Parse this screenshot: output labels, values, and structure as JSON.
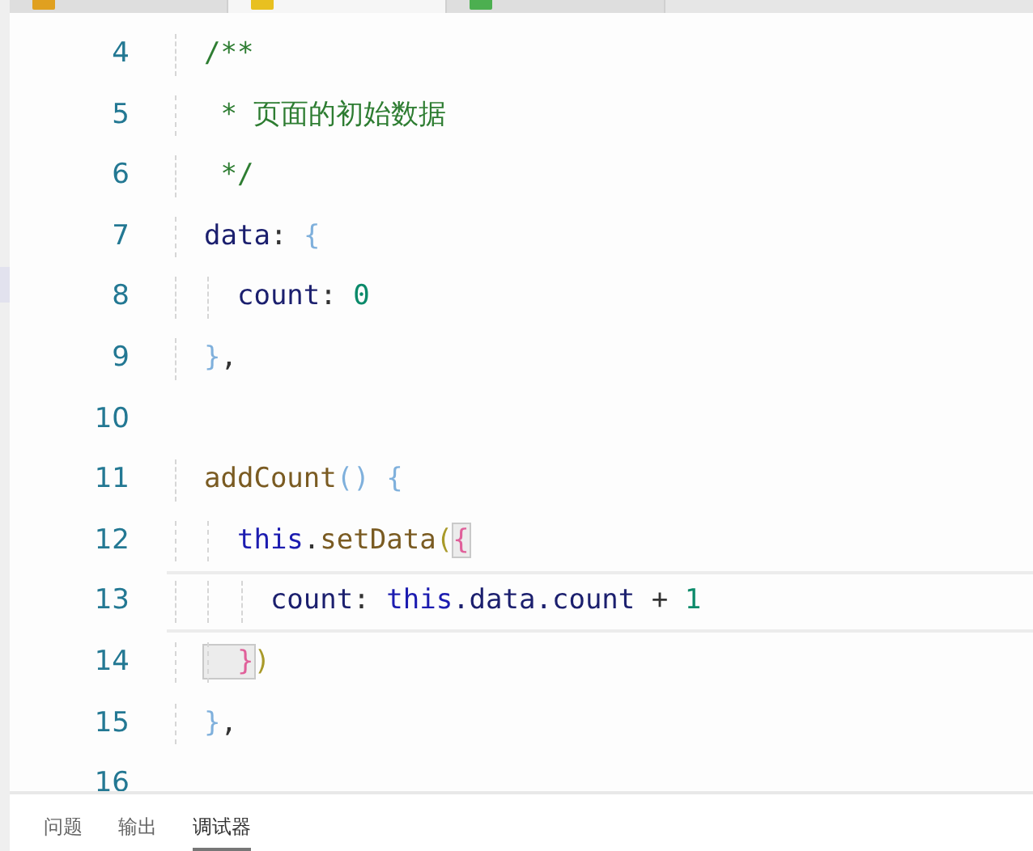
{
  "tabs": [
    {
      "selected": false
    },
    {
      "selected": true
    },
    {
      "selected": false
    }
  ],
  "editor": {
    "lines": [
      {
        "number": "4",
        "current": false,
        "tokens": [
          {
            "text": "/**",
            "kind": "comment"
          }
        ]
      },
      {
        "number": "5",
        "current": false,
        "tokens": [
          {
            "text": " * 页面的初始数据",
            "kind": "comment"
          }
        ]
      },
      {
        "number": "6",
        "current": false,
        "tokens": [
          {
            "text": " */",
            "kind": "comment"
          }
        ]
      },
      {
        "number": "7",
        "current": false,
        "tokens": [
          {
            "text": "data",
            "kind": "property"
          },
          {
            "text": ": ",
            "kind": "plain"
          },
          {
            "text": "{",
            "kind": "brace"
          }
        ]
      },
      {
        "number": "8",
        "current": false,
        "tokens": [
          {
            "text": "  count",
            "kind": "property"
          },
          {
            "text": ": ",
            "kind": "plain"
          },
          {
            "text": "0",
            "kind": "number"
          }
        ]
      },
      {
        "number": "9",
        "current": false,
        "tokens": [
          {
            "text": "}",
            "kind": "brace"
          },
          {
            "text": ",",
            "kind": "plain"
          }
        ]
      },
      {
        "number": "10",
        "current": false
      },
      {
        "number": "11",
        "current": false,
        "tokens": [
          {
            "text": "addCount",
            "kind": "function"
          },
          {
            "text": "() {",
            "kind": "brace"
          }
        ]
      },
      {
        "number": "12",
        "current": false,
        "tokens": [
          {
            "text": "  this",
            "kind": "keyword"
          },
          {
            "text": ".",
            "kind": "plain"
          },
          {
            "text": "setData",
            "kind": "function"
          },
          {
            "text": "(",
            "kind": "paren"
          },
          {
            "text": "{",
            "kind": "bracket",
            "matched": true
          }
        ]
      },
      {
        "number": "13",
        "current": true,
        "tokens": [
          {
            "text": "    count",
            "kind": "property"
          },
          {
            "text": ": ",
            "kind": "plain"
          },
          {
            "text": "this",
            "kind": "keyword"
          },
          {
            "text": ".data.count",
            "kind": "property"
          },
          {
            "text": " + ",
            "kind": "plain"
          },
          {
            "text": "1",
            "kind": "number"
          }
        ]
      },
      {
        "number": "14",
        "current": false,
        "tokens": [
          {
            "text": "  }",
            "kind": "bracket",
            "matched": true
          },
          {
            "text": ")",
            "kind": "paren"
          }
        ]
      },
      {
        "number": "15",
        "current": false,
        "tokens": [
          {
            "text": "}",
            "kind": "brace"
          },
          {
            "text": ",",
            "kind": "plain"
          }
        ]
      },
      {
        "number": "16",
        "current": false
      }
    ]
  },
  "panel_tabs": [
    {
      "label": "问题",
      "selected": false
    },
    {
      "label": "输出",
      "selected": false
    },
    {
      "label": "调试器",
      "selected": true
    }
  ]
}
